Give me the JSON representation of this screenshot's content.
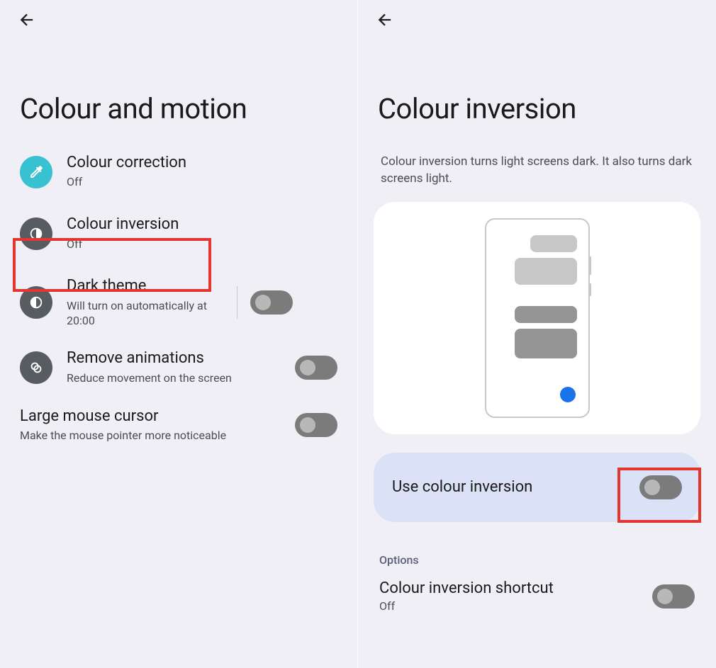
{
  "left": {
    "title": "Colour and motion",
    "items": {
      "correction": {
        "title": "Colour correction",
        "sub": "Off"
      },
      "inversion": {
        "title": "Colour inversion",
        "sub": "Off"
      },
      "dark": {
        "title": "Dark theme",
        "sub": "Will turn on automatically at 20:00"
      },
      "anim": {
        "title": "Remove animations",
        "sub": "Reduce movement on the screen"
      },
      "cursor": {
        "title": "Large mouse cursor",
        "sub": "Make the mouse pointer more noticeable"
      }
    }
  },
  "right": {
    "title": "Colour inversion",
    "desc": "Colour inversion turns light screens dark. It also turns dark screens light.",
    "useLabel": "Use colour inversion",
    "optionsLabel": "Options",
    "shortcut": {
      "title": "Colour inversion shortcut",
      "sub": "Off"
    }
  }
}
